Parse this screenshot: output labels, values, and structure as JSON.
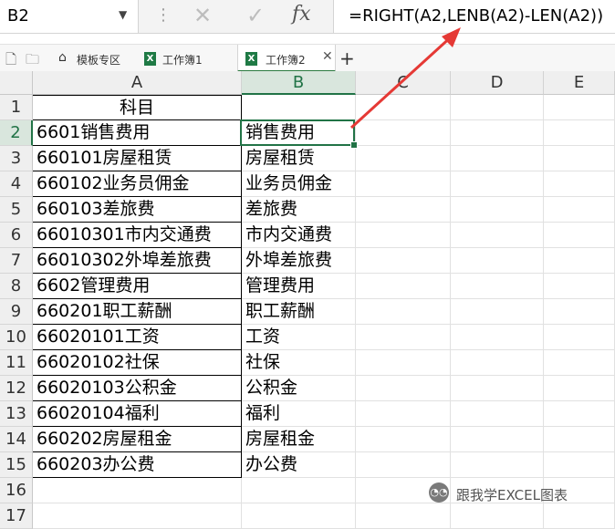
{
  "formula_bar": {
    "name_box": "B2",
    "name_dropdown_icon": "chevron-down-icon",
    "cancel_icon": "✕",
    "enter_icon": "✓",
    "fx_icon": "fx",
    "formula": "=RIGHT(A2,LENB(A2)-LEN(A2))"
  },
  "tabs": [
    {
      "label": "模板专区",
      "icon": "home-icon"
    },
    {
      "label": "工作簿1",
      "icon": "excel-icon"
    },
    {
      "label": "工作簿2",
      "icon": "excel-icon",
      "active": true
    }
  ],
  "columns": [
    "A",
    "B",
    "C",
    "D",
    "E"
  ],
  "rows": [
    "1",
    "2",
    "3",
    "4",
    "5",
    "6",
    "7",
    "8",
    "9",
    "10",
    "11",
    "12",
    "13",
    "14",
    "15",
    "16",
    "17"
  ],
  "selected_cell": "B2",
  "colA": [
    "科目",
    "6601销售费用",
    "660101房屋租赁",
    "660102业务员佣金",
    "660103差旅费",
    "66010301市内交通费",
    "66010302外埠差旅费",
    "6602管理费用",
    "660201职工薪酬",
    "66020101工资",
    "66020102社保",
    "66020103公积金",
    "66020104福利",
    "660202房屋租金",
    "660203办公费"
  ],
  "colB": [
    "",
    "销售费用",
    "房屋租赁",
    "业务员佣金",
    "差旅费",
    "市内交通费",
    "外埠差旅费",
    "管理费用",
    "职工薪酬",
    "工资",
    "社保",
    "公积金",
    "福利",
    "房屋租金",
    "办公费"
  ],
  "colors": {
    "accent": "#217346",
    "arrow": "#e53935"
  },
  "watermark": "跟我学EXCEL图表"
}
